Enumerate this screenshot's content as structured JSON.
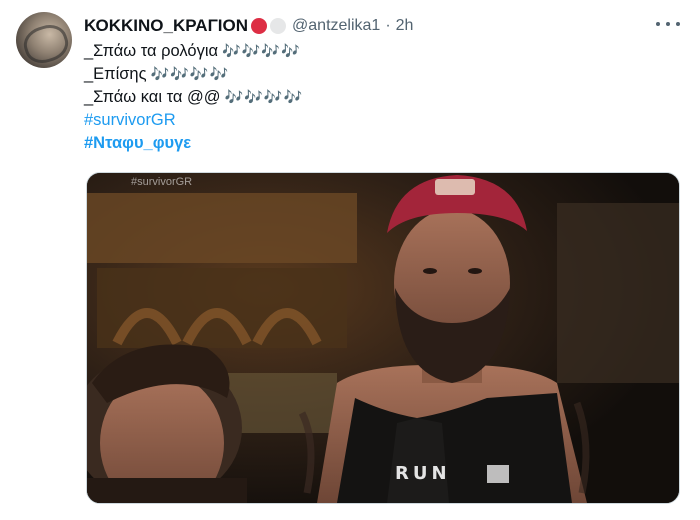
{
  "tweet": {
    "display_name": "ΚΟΚΚΙΝΟ_ΚΡΑΓΙΟΝ",
    "handle": "@antzelika1",
    "separator": "·",
    "time": "2h",
    "lines": [
      {
        "text": "_Σπάω τα ρολόγια",
        "notes": "🎶🎶🎶🎶"
      },
      {
        "text": "_Επίσης",
        "notes": "🎶🎶🎶🎶"
      },
      {
        "text": "_Σπάω και τα @@",
        "notes": "🎶🎶🎶🎶"
      }
    ],
    "hashtags": [
      "#survivorGR",
      "#Νταφυ_φυγε"
    ]
  },
  "media": {
    "watermark": "#survivorGR",
    "shirt_text": "RUN"
  },
  "icons": {
    "more": "more-horizontal-icon",
    "emoji_1": "red-circle",
    "emoji_2": "white-circle"
  },
  "colors": {
    "hashtag": "#1d9bf0",
    "handle": "#536471",
    "notes": "#4a9fd8"
  }
}
